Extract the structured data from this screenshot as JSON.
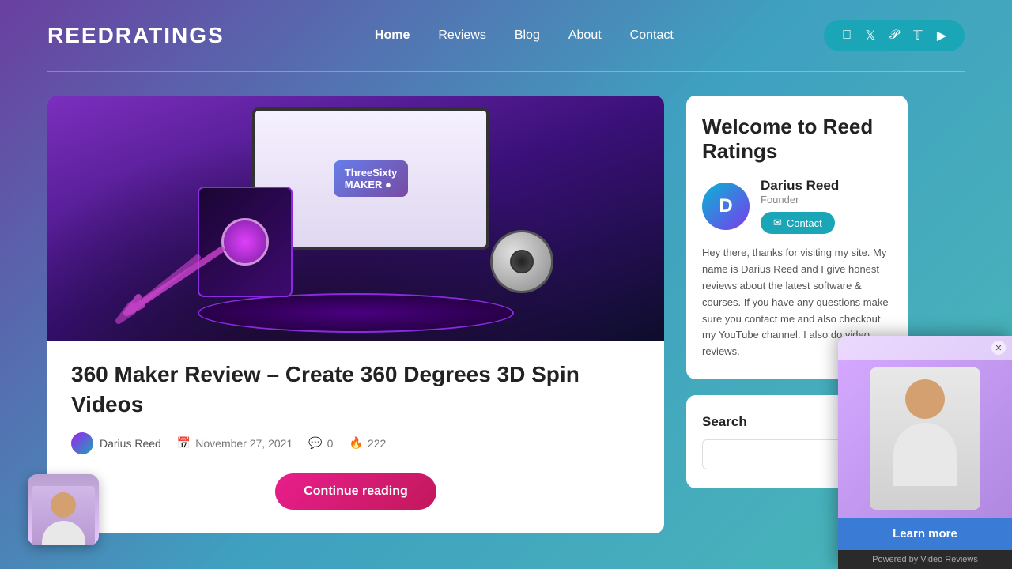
{
  "header": {
    "logo": "ReedRatings",
    "nav": {
      "items": [
        {
          "label": "Home",
          "active": true
        },
        {
          "label": "Reviews",
          "active": false
        },
        {
          "label": "Blog",
          "active": false
        },
        {
          "label": "About",
          "active": false
        },
        {
          "label": "Contact",
          "active": false
        }
      ]
    },
    "social": {
      "icons": [
        "f",
        "t",
        "p",
        "T",
        "▶"
      ]
    }
  },
  "article": {
    "title": "360 Maker Review – Create 360 Degrees 3D Spin Videos",
    "author": "Darius Reed",
    "date": "November 27, 2021",
    "comments": "0",
    "views": "222",
    "continue_label": "Continue reading"
  },
  "sidebar": {
    "welcome": {
      "title": "Welcome to Reed Ratings",
      "author_name": "Darius",
      "author_full": "Darius Reed",
      "author_role": "Founder",
      "contact_label": "Contact",
      "description": "Hey there, thanks for visiting my site. My name is Darius Reed and I give honest reviews about the latest software & courses. If you have any questions make sure you contact me and also checkout my YouTube channel. I also do video reviews."
    },
    "search": {
      "title": "Search",
      "placeholder": ""
    }
  },
  "video_popup": {
    "learn_more_label": "Learn more",
    "powered_by": "Powered by Video Reviews"
  }
}
